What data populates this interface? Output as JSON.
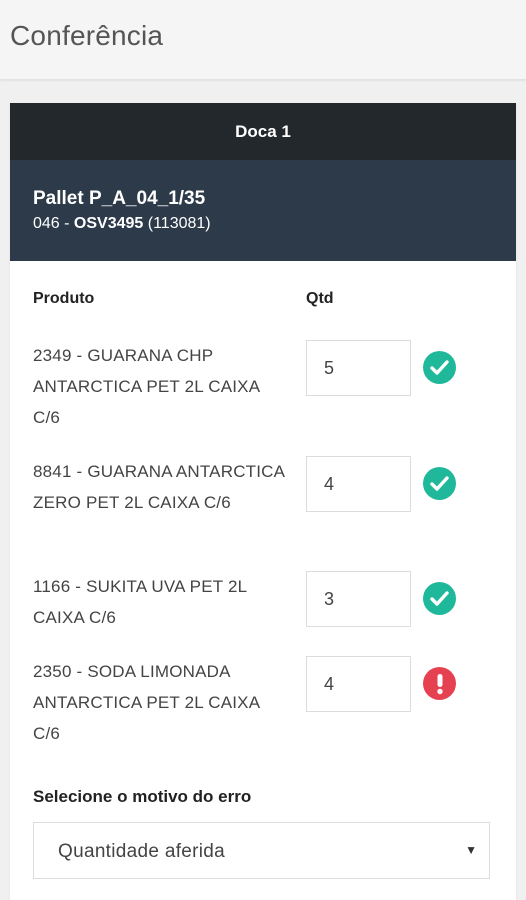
{
  "page": {
    "title": "Conferência"
  },
  "dock": {
    "title": "Doca 1"
  },
  "pallet": {
    "title": "Pallet P_A_04_1/35",
    "code_prefix": "046 - ",
    "code_bold": "OSV3495",
    "code_suffix": " (113081)"
  },
  "table": {
    "col_product": "Produto",
    "col_qty": "Qtd",
    "rows": [
      {
        "desc": "2349 - GUARANA CHP ANTARCTICA PET 2L CAIXA C/6",
        "qty": "5",
        "status": "ok",
        "icon": "check-circle-icon"
      },
      {
        "desc": "8841 - GUARANA ANTARCTICA ZERO PET 2L CAIXA C/6",
        "qty": "4",
        "status": "ok",
        "icon": "check-circle-icon"
      },
      {
        "desc": "1166 - SUKITA UVA PET 2L CAIXA C/6",
        "qty": "3",
        "status": "ok",
        "icon": "check-circle-icon"
      },
      {
        "desc": "2350 - SODA LIMONADA ANTARCTICA PET 2L CAIXA C/6",
        "qty": "4",
        "status": "error",
        "icon": "exclamation-circle-icon"
      }
    ]
  },
  "error": {
    "label": "Selecione o motivo do erro",
    "selected": "Quantidade aferida"
  },
  "colors": {
    "ok": "#1fb89a",
    "error": "#e64150",
    "dock_header": "#23282d",
    "pallet_header": "#2d3a4a"
  }
}
